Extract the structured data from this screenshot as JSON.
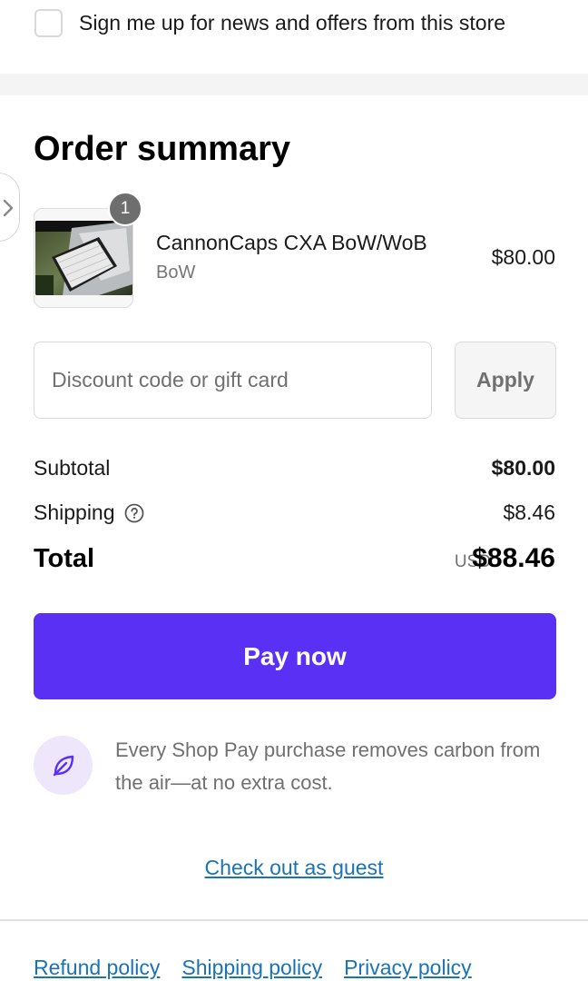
{
  "signup": {
    "label": "Sign me up for news and offers from this store",
    "checked": false
  },
  "summary": {
    "title": "Order summary"
  },
  "product": {
    "quantity": "1",
    "name": "CannonCaps CXA BoW/WoB",
    "variant": "BoW",
    "price": "$80.00"
  },
  "discount": {
    "placeholder": "Discount code or gift card",
    "apply_label": "Apply"
  },
  "totals": {
    "subtotal_label": "Subtotal",
    "subtotal_value": "$80.00",
    "shipping_label": "Shipping",
    "shipping_value": "$8.46",
    "total_label": "Total",
    "currency": "USD",
    "total_value": "$88.46"
  },
  "pay": {
    "label": "Pay now",
    "color": "#5a31f4"
  },
  "carbon": {
    "text": "Every Shop Pay purchase removes carbon from the air—at no extra cost.",
    "icon": "leaf-icon"
  },
  "guest": {
    "label": "Check out as guest"
  },
  "policies": {
    "refund": "Refund policy",
    "shipping": "Shipping policy",
    "privacy": "Privacy policy"
  },
  "colors": {
    "link": "#1a73b5",
    "accent": "#5a31f4",
    "muted": "#707070"
  }
}
